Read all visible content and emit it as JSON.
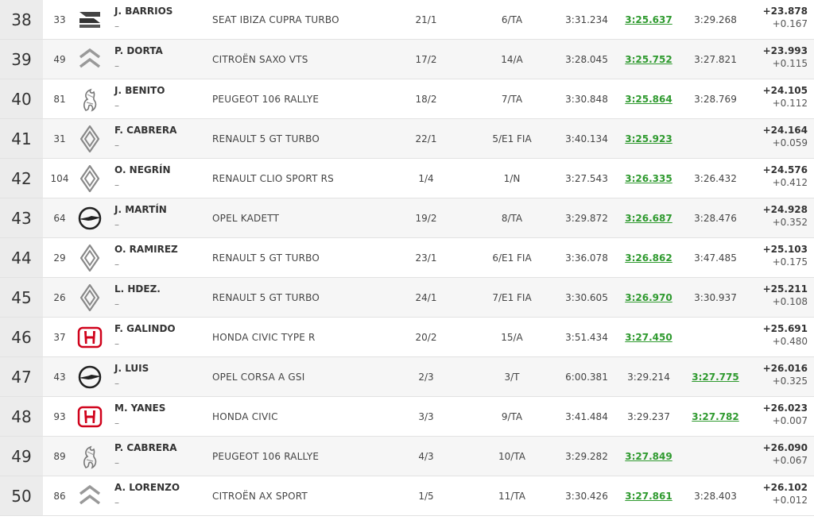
{
  "results": [
    {
      "pos": "38",
      "num": "33",
      "brand": "seat",
      "driver": "J. BARRIOS",
      "codriver": "–",
      "car": "SEAT IBIZA CUPRA TURBO",
      "overall": "21/1",
      "class": "6/TA",
      "t1": "3:31.234",
      "t2": "3:25.637",
      "t3": "3:29.268",
      "best": 2,
      "gap": "+23.878",
      "diff": "+0.167"
    },
    {
      "pos": "39",
      "num": "49",
      "brand": "citroen",
      "driver": "P. DORTA",
      "codriver": "–",
      "car": "CITROËN SAXO VTS",
      "overall": "17/2",
      "class": "14/A",
      "t1": "3:28.045",
      "t2": "3:25.752",
      "t3": "3:27.821",
      "best": 2,
      "gap": "+23.993",
      "diff": "+0.115"
    },
    {
      "pos": "40",
      "num": "81",
      "brand": "peugeot",
      "driver": "J. BENITO",
      "codriver": "–",
      "car": "PEUGEOT 106 RALLYE",
      "overall": "18/2",
      "class": "7/TA",
      "t1": "3:30.848",
      "t2": "3:25.864",
      "t3": "3:28.769",
      "best": 2,
      "gap": "+24.105",
      "diff": "+0.112"
    },
    {
      "pos": "41",
      "num": "31",
      "brand": "renault",
      "driver": "F. CABRERA",
      "codriver": "–",
      "car": "RENAULT 5 GT TURBO",
      "overall": "22/1",
      "class": "5/E1 FIA",
      "t1": "3:40.134",
      "t2": "3:25.923",
      "t3": "",
      "best": 2,
      "gap": "+24.164",
      "diff": "+0.059"
    },
    {
      "pos": "42",
      "num": "104",
      "brand": "renault",
      "driver": "O. NEGRÍN",
      "codriver": "–",
      "car": "RENAULT CLIO SPORT RS",
      "overall": "1/4",
      "class": "1/N",
      "t1": "3:27.543",
      "t2": "3:26.335",
      "t3": "3:26.432",
      "best": 2,
      "gap": "+24.576",
      "diff": "+0.412"
    },
    {
      "pos": "43",
      "num": "64",
      "brand": "opel",
      "driver": "J. MARTÍN",
      "codriver": "–",
      "car": "OPEL KADETT",
      "overall": "19/2",
      "class": "8/TA",
      "t1": "3:29.872",
      "t2": "3:26.687",
      "t3": "3:28.476",
      "best": 2,
      "gap": "+24.928",
      "diff": "+0.352"
    },
    {
      "pos": "44",
      "num": "29",
      "brand": "renault",
      "driver": "O. RAMIREZ",
      "codriver": "–",
      "car": "RENAULT 5 GT TURBO",
      "overall": "23/1",
      "class": "6/E1 FIA",
      "t1": "3:36.078",
      "t2": "3:26.862",
      "t3": "3:47.485",
      "best": 2,
      "gap": "+25.103",
      "diff": "+0.175"
    },
    {
      "pos": "45",
      "num": "26",
      "brand": "renault",
      "driver": "L. HDEZ.",
      "codriver": "–",
      "car": "RENAULT 5 GT TURBO",
      "overall": "24/1",
      "class": "7/E1 FIA",
      "t1": "3:30.605",
      "t2": "3:26.970",
      "t3": "3:30.937",
      "best": 2,
      "gap": "+25.211",
      "diff": "+0.108"
    },
    {
      "pos": "46",
      "num": "37",
      "brand": "honda",
      "driver": "F. GALINDO",
      "codriver": "–",
      "car": "HONDA CIVIC TYPE R",
      "overall": "20/2",
      "class": "15/A",
      "t1": "3:51.434",
      "t2": "3:27.450",
      "t3": "",
      "best": 2,
      "gap": "+25.691",
      "diff": "+0.480"
    },
    {
      "pos": "47",
      "num": "43",
      "brand": "opel",
      "driver": "J. LUIS",
      "codriver": "–",
      "car": "OPEL CORSA A GSI",
      "overall": "2/3",
      "class": "3/T",
      "t1": "6:00.381",
      "t2": "3:29.214",
      "t3": "3:27.775",
      "best": 3,
      "gap": "+26.016",
      "diff": "+0.325"
    },
    {
      "pos": "48",
      "num": "93",
      "brand": "honda",
      "driver": "M. YANES",
      "codriver": "–",
      "car": "HONDA CIVIC",
      "overall": "3/3",
      "class": "9/TA",
      "t1": "3:41.484",
      "t2": "3:29.237",
      "t3": "3:27.782",
      "best": 3,
      "gap": "+26.023",
      "diff": "+0.007"
    },
    {
      "pos": "49",
      "num": "89",
      "brand": "peugeot",
      "driver": "P. CABRERA",
      "codriver": "–",
      "car": "PEUGEOT 106 RALLYE",
      "overall": "4/3",
      "class": "10/TA",
      "t1": "3:29.282",
      "t2": "3:27.849",
      "t3": "",
      "best": 2,
      "gap": "+26.090",
      "diff": "+0.067"
    },
    {
      "pos": "50",
      "num": "86",
      "brand": "citroen",
      "driver": "A. LORENZO",
      "codriver": "–",
      "car": "CITROËN AX SPORT",
      "overall": "1/5",
      "class": "11/TA",
      "t1": "3:30.426",
      "t2": "3:27.861",
      "t3": "3:28.403",
      "best": 2,
      "gap": "+26.102",
      "diff": "+0.012"
    }
  ],
  "colors": {
    "best": "#2f9a2f",
    "honda": "#d0021b",
    "pos_bg": "#ececec"
  }
}
